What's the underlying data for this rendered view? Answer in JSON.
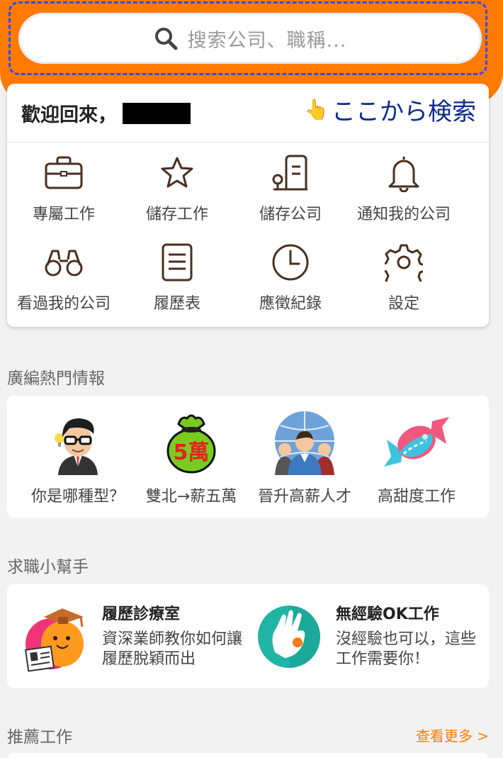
{
  "search": {
    "placeholder": "搜索公司、職稱..."
  },
  "welcome": {
    "greeting": "歡迎回來，",
    "hint": "ここから検索",
    "hint_icon": "pointing-hand-icon"
  },
  "menu": [
    {
      "label": "專屬工作",
      "icon": "briefcase-icon"
    },
    {
      "label": "儲存工作",
      "icon": "star-icon"
    },
    {
      "label": "儲存公司",
      "icon": "building-icon"
    },
    {
      "label": "通知我的公司",
      "icon": "bell-icon"
    },
    {
      "label": "看過我的公司",
      "icon": "binoculars-icon"
    },
    {
      "label": "履歷表",
      "icon": "document-icon"
    },
    {
      "label": "應徵紀錄",
      "icon": "clock-icon"
    },
    {
      "label": "設定",
      "icon": "gear-icon"
    }
  ],
  "hot": {
    "title": "廣編熱門情報",
    "items": [
      {
        "label": "你是哪種型？",
        "icon": "man-with-glasses-icon"
      },
      {
        "label": "雙北→薪五萬",
        "icon": "money-bag-5-icon"
      },
      {
        "label": "晉升高薪人才",
        "icon": "people-globe-icon"
      },
      {
        "label": "高甜度工作",
        "icon": "candy-icon"
      }
    ],
    "money_bag_text": "5萬"
  },
  "helper": {
    "title": "求職小幫手",
    "items": [
      {
        "title": "履歷診療室",
        "desc": "資深業師教你如何讓履歷脫穎而出",
        "icon": "mascot-resume-icon"
      },
      {
        "title": "無經驗OK工作",
        "desc": "沒經驗也可以，這些工作需要你！",
        "icon": "ok-hand-icon"
      }
    ]
  },
  "recommend": {
    "title": "推薦工作",
    "more": "查看更多 >"
  },
  "colors": {
    "brand": "#ff7a00",
    "hint": "#0b2a8c",
    "icon_stroke": "#4a2f1e"
  }
}
